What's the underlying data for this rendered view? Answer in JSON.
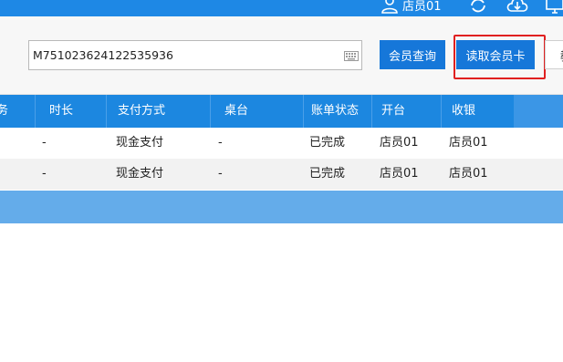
{
  "header": {
    "user_name": "店员01"
  },
  "toolbar": {
    "card_number": "M751023624122535936",
    "query_button": "会员查询",
    "read_card_button": "读取会员卡",
    "more_button_partial": "教"
  },
  "table": {
    "columns": [
      "务",
      "时长",
      "支付方式",
      "桌台",
      "账单状态",
      "开台",
      "收银"
    ],
    "rows": [
      [
        "",
        "-",
        "现金支付",
        "-",
        "已完成",
        "店员01",
        "店员01"
      ],
      [
        "",
        "-",
        "现金支付",
        "-",
        "已完成",
        "店员01",
        "店员01"
      ]
    ]
  },
  "colors": {
    "header_blue": "#1e88e5",
    "button_blue": "#1677d9",
    "highlight_red": "#e02020",
    "footer_blue": "#64acea"
  },
  "icons": [
    "user-icon",
    "refresh-icon",
    "cloud-download-icon",
    "monitor-icon",
    "keyboard-icon"
  ]
}
